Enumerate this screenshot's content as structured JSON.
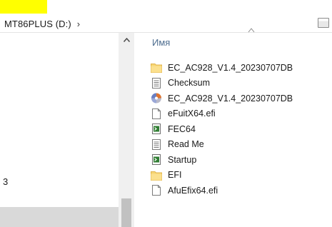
{
  "breadcrumb": {
    "path_label": "MT86PLUS (D:)",
    "separator": "›"
  },
  "list": {
    "column_header": "Имя",
    "sort_indicator": "^",
    "files": [
      {
        "name": "EC_AC928_V1.4_20230707DB",
        "icon": "folder-icon"
      },
      {
        "name": "Checksum",
        "icon": "text-document-icon"
      },
      {
        "name": "EC_AC928_V1.4_20230707DB",
        "icon": "disc-image-icon"
      },
      {
        "name": "eFuitX64.efi",
        "icon": "blank-file-icon"
      },
      {
        "name": "FEC64",
        "icon": "script-file-icon"
      },
      {
        "name": "Read Me",
        "icon": "text-document-icon"
      },
      {
        "name": "Startup",
        "icon": "script-file-icon"
      },
      {
        "name": "EFI",
        "icon": "folder-icon"
      },
      {
        "name": "AfuEfix64.efi",
        "icon": "blank-file-icon"
      }
    ]
  },
  "nav": {
    "partial_label": "3"
  },
  "colors": {
    "highlight": "#ffff00",
    "folder": "#f7d674",
    "header_text": "#4d6d8f",
    "selection": "#d9d9d9"
  }
}
